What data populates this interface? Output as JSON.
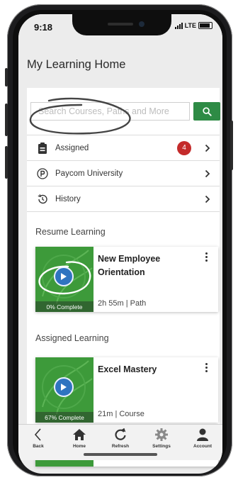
{
  "status": {
    "time": "9:18",
    "carrier": "LTE"
  },
  "header": {
    "title": "My Learning Home"
  },
  "search": {
    "placeholder": "Search Courses, Paths and More"
  },
  "menu": {
    "items": [
      {
        "label": "Assigned",
        "badge": "4",
        "icon": "clipboard-icon"
      },
      {
        "label": "Paycom University",
        "icon": "paycom-p-icon"
      },
      {
        "label": "History",
        "icon": "history-icon"
      }
    ]
  },
  "resume": {
    "title": "Resume Learning",
    "card": {
      "title": "New Employee Orientation",
      "meta": "2h 55m | Path",
      "progress_caption": "0% Complete",
      "progress": 0
    }
  },
  "assigned": {
    "title": "Assigned Learning",
    "card": {
      "title": "Excel Mastery",
      "meta": "21m | Course",
      "progress_caption": "67% Complete",
      "progress": 0.67
    }
  },
  "tabbar": {
    "items": [
      {
        "label": "Back",
        "icon": "back-chevron-icon"
      },
      {
        "label": "Home",
        "icon": "home-icon"
      },
      {
        "label": "Refresh",
        "icon": "refresh-icon"
      },
      {
        "label": "Settings",
        "icon": "gear-icon"
      },
      {
        "label": "Account",
        "icon": "account-icon"
      }
    ]
  },
  "colors": {
    "accent": "#2e8b45",
    "badge": "#c42b2b",
    "play": "#2f74c0"
  }
}
